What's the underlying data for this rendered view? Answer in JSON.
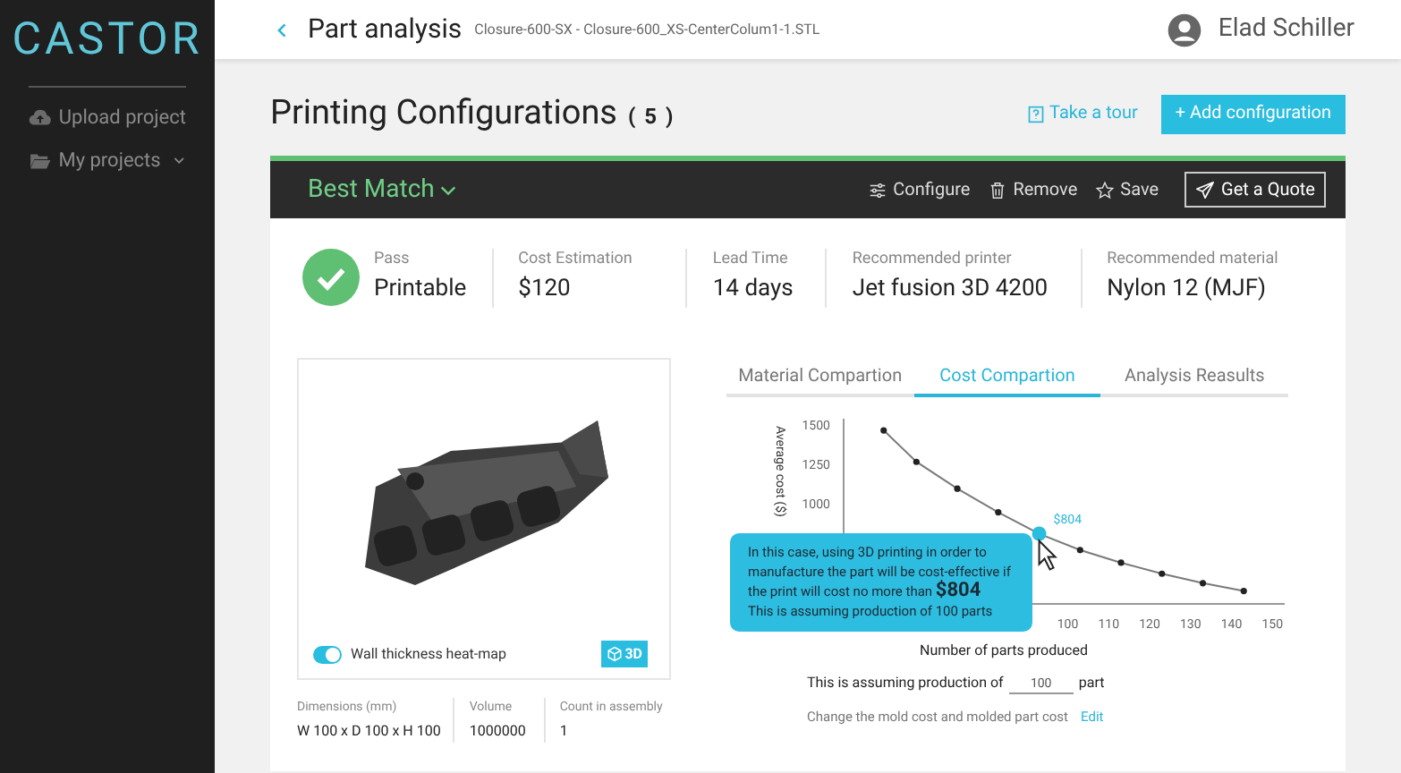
{
  "sidebar": {
    "logo": "CASTOR",
    "items": [
      {
        "label": "Upload project",
        "kind": "upload",
        "expandable": false
      },
      {
        "label": "My projects",
        "kind": "folder",
        "expandable": true
      }
    ]
  },
  "header": {
    "title": "Part analysis",
    "file": "Closure-600-SX - Closure-600_XS-CenterColum1-1.STL",
    "user": "Elad Schiller"
  },
  "page": {
    "title": "Printing Configurations",
    "count": "( 5 )",
    "tour": "Take a tour",
    "add": "+ Add configuration"
  },
  "configuration": {
    "name": "Best Match",
    "actions": [
      {
        "label": "Configure",
        "kind": "configure"
      },
      {
        "label": "Remove",
        "kind": "remove"
      },
      {
        "label": "Save",
        "kind": "save"
      },
      {
        "label": "Get a Quote",
        "kind": "quote"
      }
    ],
    "summary": [
      {
        "label": "Pass",
        "value": "Printable",
        "kind": "status"
      },
      {
        "label": "Cost Estimation",
        "value": "$120",
        "kind": "plain"
      },
      {
        "label": "Lead Time",
        "value": "14 days",
        "kind": "plain"
      },
      {
        "label": "Recommended printer",
        "value": "Jet fusion 3D 4200",
        "kind": "plain"
      },
      {
        "label": "Recommended material",
        "value": "Nylon 12 (MJF)",
        "kind": "plain"
      }
    ],
    "viewer": {
      "kind": "picture",
      "heat_map": {
        "label": "Wall thickness heat-map",
        "on": true
      },
      "view_3d": "3D"
    },
    "properties": [
      {
        "label": "Dimensions (mm)",
        "value": "W 100 x D 100 x H 100"
      },
      {
        "label": "Volume",
        "value": "1000000"
      },
      {
        "label": "Count in assembly",
        "value": "1"
      }
    ],
    "tabs": [
      {
        "label": "Material Compartion",
        "selected": false
      },
      {
        "label": "Cost Compartion",
        "selected": true
      },
      {
        "label": "Analysis Reasults",
        "selected": false
      }
    ],
    "chart": {
      "chart_data": {
        "type": "line",
        "xlabel": "Number of parts produced",
        "ylabel": "Average cost ($)",
        "x": [
          55,
          63,
          73,
          83,
          93,
          103,
          113,
          123,
          133,
          143
        ],
        "series": [
          {
            "color": "#222222",
            "marker": "circle",
            "values": [
              1460,
              1260,
              1090,
              940,
              804,
              700,
              620,
              550,
              490,
              440
            ]
          }
        ],
        "xlim": [
          45,
          153
        ],
        "ylim": [
          364,
          1534
        ],
        "xticks": [
          100,
          110,
          120,
          130,
          140,
          150
        ],
        "yticks": [
          1000,
          1250,
          1500
        ],
        "annotations": [
          {
            "x": 93,
            "y": 804,
            "text": "$804"
          }
        ]
      },
      "tooltip": {
        "message": "In this case, using 3D printing in order to manufacture the part will be cost-effective if the print will cost no more than **$804**",
        "note": "This is assuming production of 100 parts"
      }
    },
    "production": {
      "label": "This is assuming production of",
      "value": "100",
      "unit": "part"
    },
    "mold": {
      "text": "Change the mold cost and molded part cost",
      "link": "Edit"
    }
  }
}
